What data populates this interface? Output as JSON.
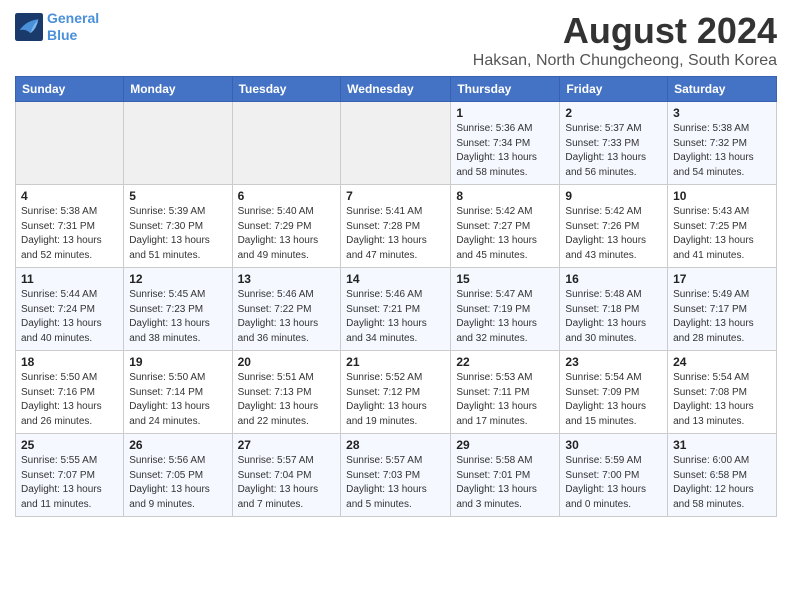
{
  "logo": {
    "line1": "General",
    "line2": "Blue"
  },
  "title": "August 2024",
  "location": "Haksan, North Chungcheong, South Korea",
  "days_of_week": [
    "Sunday",
    "Monday",
    "Tuesday",
    "Wednesday",
    "Thursday",
    "Friday",
    "Saturday"
  ],
  "weeks": [
    [
      {
        "day": "",
        "info": ""
      },
      {
        "day": "",
        "info": ""
      },
      {
        "day": "",
        "info": ""
      },
      {
        "day": "",
        "info": ""
      },
      {
        "day": "1",
        "info": "Sunrise: 5:36 AM\nSunset: 7:34 PM\nDaylight: 13 hours\nand 58 minutes."
      },
      {
        "day": "2",
        "info": "Sunrise: 5:37 AM\nSunset: 7:33 PM\nDaylight: 13 hours\nand 56 minutes."
      },
      {
        "day": "3",
        "info": "Sunrise: 5:38 AM\nSunset: 7:32 PM\nDaylight: 13 hours\nand 54 minutes."
      }
    ],
    [
      {
        "day": "4",
        "info": "Sunrise: 5:38 AM\nSunset: 7:31 PM\nDaylight: 13 hours\nand 52 minutes."
      },
      {
        "day": "5",
        "info": "Sunrise: 5:39 AM\nSunset: 7:30 PM\nDaylight: 13 hours\nand 51 minutes."
      },
      {
        "day": "6",
        "info": "Sunrise: 5:40 AM\nSunset: 7:29 PM\nDaylight: 13 hours\nand 49 minutes."
      },
      {
        "day": "7",
        "info": "Sunrise: 5:41 AM\nSunset: 7:28 PM\nDaylight: 13 hours\nand 47 minutes."
      },
      {
        "day": "8",
        "info": "Sunrise: 5:42 AM\nSunset: 7:27 PM\nDaylight: 13 hours\nand 45 minutes."
      },
      {
        "day": "9",
        "info": "Sunrise: 5:42 AM\nSunset: 7:26 PM\nDaylight: 13 hours\nand 43 minutes."
      },
      {
        "day": "10",
        "info": "Sunrise: 5:43 AM\nSunset: 7:25 PM\nDaylight: 13 hours\nand 41 minutes."
      }
    ],
    [
      {
        "day": "11",
        "info": "Sunrise: 5:44 AM\nSunset: 7:24 PM\nDaylight: 13 hours\nand 40 minutes."
      },
      {
        "day": "12",
        "info": "Sunrise: 5:45 AM\nSunset: 7:23 PM\nDaylight: 13 hours\nand 38 minutes."
      },
      {
        "day": "13",
        "info": "Sunrise: 5:46 AM\nSunset: 7:22 PM\nDaylight: 13 hours\nand 36 minutes."
      },
      {
        "day": "14",
        "info": "Sunrise: 5:46 AM\nSunset: 7:21 PM\nDaylight: 13 hours\nand 34 minutes."
      },
      {
        "day": "15",
        "info": "Sunrise: 5:47 AM\nSunset: 7:19 PM\nDaylight: 13 hours\nand 32 minutes."
      },
      {
        "day": "16",
        "info": "Sunrise: 5:48 AM\nSunset: 7:18 PM\nDaylight: 13 hours\nand 30 minutes."
      },
      {
        "day": "17",
        "info": "Sunrise: 5:49 AM\nSunset: 7:17 PM\nDaylight: 13 hours\nand 28 minutes."
      }
    ],
    [
      {
        "day": "18",
        "info": "Sunrise: 5:50 AM\nSunset: 7:16 PM\nDaylight: 13 hours\nand 26 minutes."
      },
      {
        "day": "19",
        "info": "Sunrise: 5:50 AM\nSunset: 7:14 PM\nDaylight: 13 hours\nand 24 minutes."
      },
      {
        "day": "20",
        "info": "Sunrise: 5:51 AM\nSunset: 7:13 PM\nDaylight: 13 hours\nand 22 minutes."
      },
      {
        "day": "21",
        "info": "Sunrise: 5:52 AM\nSunset: 7:12 PM\nDaylight: 13 hours\nand 19 minutes."
      },
      {
        "day": "22",
        "info": "Sunrise: 5:53 AM\nSunset: 7:11 PM\nDaylight: 13 hours\nand 17 minutes."
      },
      {
        "day": "23",
        "info": "Sunrise: 5:54 AM\nSunset: 7:09 PM\nDaylight: 13 hours\nand 15 minutes."
      },
      {
        "day": "24",
        "info": "Sunrise: 5:54 AM\nSunset: 7:08 PM\nDaylight: 13 hours\nand 13 minutes."
      }
    ],
    [
      {
        "day": "25",
        "info": "Sunrise: 5:55 AM\nSunset: 7:07 PM\nDaylight: 13 hours\nand 11 minutes."
      },
      {
        "day": "26",
        "info": "Sunrise: 5:56 AM\nSunset: 7:05 PM\nDaylight: 13 hours\nand 9 minutes."
      },
      {
        "day": "27",
        "info": "Sunrise: 5:57 AM\nSunset: 7:04 PM\nDaylight: 13 hours\nand 7 minutes."
      },
      {
        "day": "28",
        "info": "Sunrise: 5:57 AM\nSunset: 7:03 PM\nDaylight: 13 hours\nand 5 minutes."
      },
      {
        "day": "29",
        "info": "Sunrise: 5:58 AM\nSunset: 7:01 PM\nDaylight: 13 hours\nand 3 minutes."
      },
      {
        "day": "30",
        "info": "Sunrise: 5:59 AM\nSunset: 7:00 PM\nDaylight: 13 hours\nand 0 minutes."
      },
      {
        "day": "31",
        "info": "Sunrise: 6:00 AM\nSunset: 6:58 PM\nDaylight: 12 hours\nand 58 minutes."
      }
    ]
  ]
}
